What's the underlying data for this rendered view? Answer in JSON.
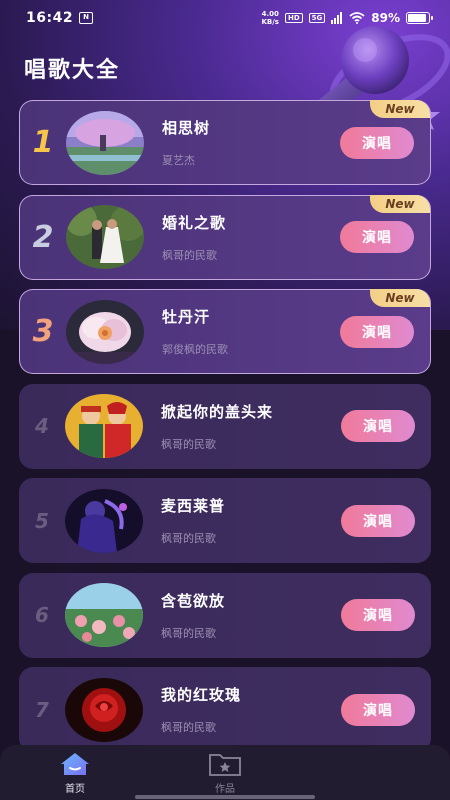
{
  "status_bar": {
    "time": "16:42",
    "app_badge": "N",
    "net_speed_value": "4.00",
    "net_speed_unit": "KB/s",
    "hd_badge": "HD",
    "signal_badge": "5G",
    "battery": "89%"
  },
  "page": {
    "title": "唱歌大全"
  },
  "songs": [
    {
      "rank": "1",
      "title": "相思树",
      "artist": "夏艺杰",
      "badge": "New",
      "button": "演唱"
    },
    {
      "rank": "2",
      "title": "婚礼之歌",
      "artist": "枫哥的民歌",
      "badge": "New",
      "button": "演唱"
    },
    {
      "rank": "3",
      "title": "牡丹汗",
      "artist": "郭俊枫的民歌",
      "badge": "New",
      "button": "演唱"
    },
    {
      "rank": "4",
      "title": "掀起你的盖头来",
      "artist": "枫哥的民歌",
      "badge": "",
      "button": "演唱"
    },
    {
      "rank": "5",
      "title": "麦西莱普",
      "artist": "枫哥的民歌",
      "badge": "",
      "button": "演唱"
    },
    {
      "rank": "6",
      "title": "含苞欲放",
      "artist": "枫哥的民歌",
      "badge": "",
      "button": "演唱"
    },
    {
      "rank": "7",
      "title": "我的红玫瑰",
      "artist": "枫哥的民歌",
      "badge": "",
      "button": "演唱"
    }
  ],
  "nav": {
    "home": {
      "label": "首页",
      "icon": "home-icon"
    },
    "works": {
      "label": "作品",
      "icon": "folder-star-icon"
    }
  },
  "colors": {
    "accent_button_start": "#f07a9a",
    "accent_button_end": "#e08ad0",
    "rank_gold": "#f5c64a",
    "rank_silver": "#c8cde0",
    "rank_bronze": "#f2a37d",
    "new_badge": "#f3cf86"
  }
}
